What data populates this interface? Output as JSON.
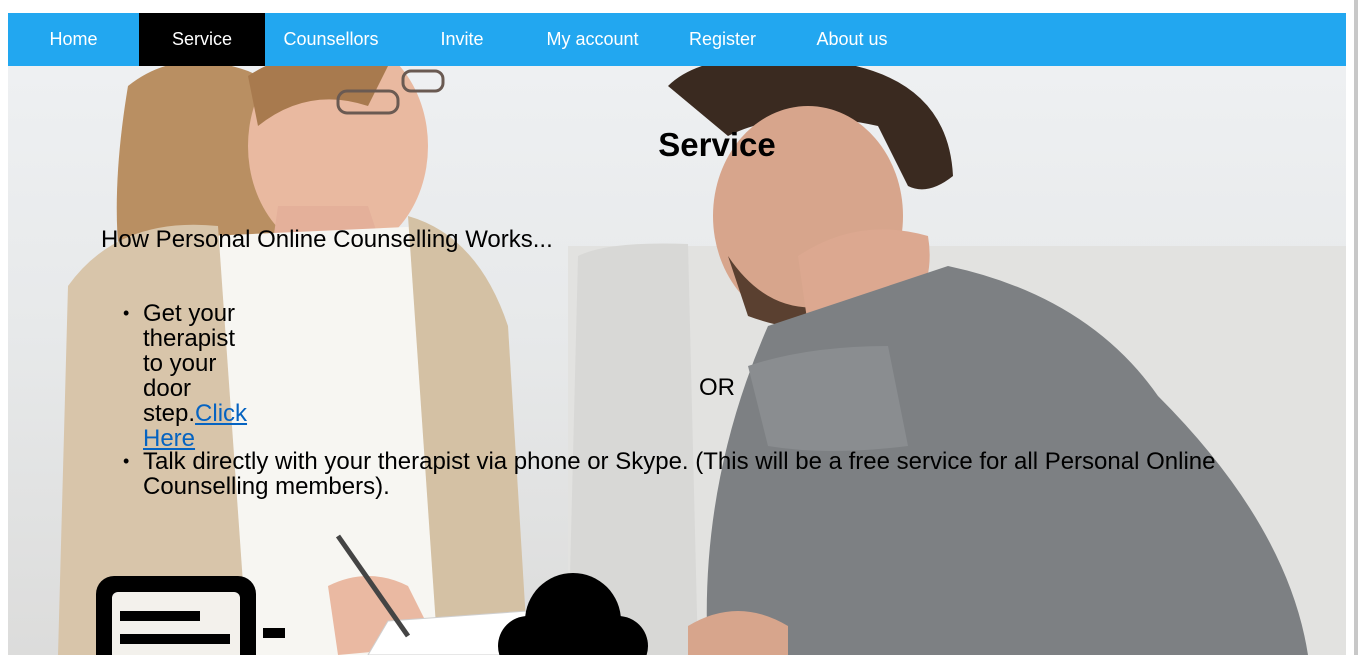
{
  "nav": {
    "items": [
      {
        "label": "Home",
        "active": false
      },
      {
        "label": "Service",
        "active": true
      },
      {
        "label": "Counsellors",
        "active": false
      },
      {
        "label": "Invite",
        "active": false
      },
      {
        "label": "My account",
        "active": false
      },
      {
        "label": "Register",
        "active": false
      },
      {
        "label": "About us",
        "active": false
      }
    ]
  },
  "content": {
    "title": "Service",
    "intro": "How Personal Online Counselling Works...",
    "bullet1_text": "Get your therapist to your door step.",
    "bullet1_link": "Click Here",
    "or_text": "OR",
    "bullet2_line1": "Talk directly with your therapist via phone or Skype. (This will be a free service for all Personal Online",
    "bullet2_line2": "Counselling members)."
  },
  "icons": {
    "left": "document-icon",
    "right": "group-users-icon"
  },
  "colors": {
    "nav_bg": "#22a7f0",
    "nav_active_bg": "#000000",
    "nav_text": "#ffffff",
    "link": "#0563c1"
  }
}
